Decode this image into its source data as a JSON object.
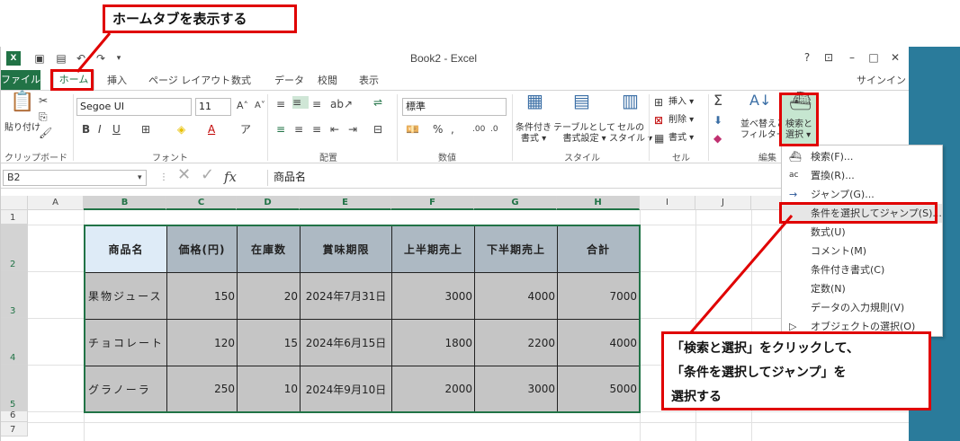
{
  "window": {
    "title": "Book2 - Excel",
    "help": "?",
    "signin": "サインイン"
  },
  "tabs": [
    "ファイル",
    "ホーム",
    "挿入",
    "ページ レイアウト",
    "数式",
    "データ",
    "校閲",
    "表示"
  ],
  "ribbon": {
    "paste": "貼り付け",
    "font_name": "Segoe UI",
    "font_size": "11",
    "number_format": "標準",
    "styles": {
      "conditional": "条件付き\n書式 ▾",
      "table": "テーブルとして\n書式設定 ▾",
      "cell": "セルの\nスタイル ▾"
    },
    "cells": {
      "insert": "挿入 ▾",
      "delete": "削除 ▾",
      "format": "書式 ▾"
    },
    "edit": {
      "sort": "並べ替えと\nフィルター ▾",
      "find": "検索と\n選択 ▾"
    },
    "groups": [
      "クリップボード",
      "フォント",
      "配置",
      "数値",
      "スタイル",
      "セル",
      "編集"
    ]
  },
  "formula_bar": {
    "name_box": "B2",
    "fx": "fx",
    "content": "商品名"
  },
  "columns": [
    "A",
    "B",
    "C",
    "D",
    "E",
    "F",
    "G",
    "H",
    "I",
    "J",
    "K"
  ],
  "rows": [
    "1",
    "2",
    "3",
    "4",
    "5",
    "6",
    "7"
  ],
  "table": {
    "headers": [
      "商品名",
      "価格(円)",
      "在庫数",
      "賞味期限",
      "上半期売上",
      "下半期売上",
      "合計"
    ],
    "rows": [
      [
        "果物ジュース",
        "150",
        "20",
        "2024年7月31日",
        "3000",
        "4000",
        "7000"
      ],
      [
        "チョコレート",
        "120",
        "15",
        "2024年6月15日",
        "1800",
        "2200",
        "4000"
      ],
      [
        "グラノーラ",
        "250",
        "10",
        "2024年9月10日",
        "2000",
        "3000",
        "5000"
      ]
    ]
  },
  "menu": [
    {
      "icon": "binoculars-icon",
      "label": "検索(F)..."
    },
    {
      "icon": "replace-icon",
      "label": "置換(R)..."
    },
    {
      "icon": "arrow-right-icon",
      "label": "ジャンプ(G)..."
    },
    {
      "icon": "",
      "label": "条件を選択してジャンプ(S)..."
    },
    {
      "icon": "",
      "label": "数式(U)"
    },
    {
      "icon": "",
      "label": "コメント(M)"
    },
    {
      "icon": "",
      "label": "条件付き書式(C)"
    },
    {
      "icon": "",
      "label": "定数(N)"
    },
    {
      "icon": "",
      "label": "データの入力規則(V)"
    },
    {
      "icon": "cursor-icon",
      "label": "オブジェクトの選択(O)"
    }
  ],
  "callouts": {
    "home_tab": "ホームタブを表示する",
    "find_select": "「検索と選択」をクリックして、\n「条件を選択してジャンプ」を\n選択する"
  },
  "colors": {
    "excel_green": "#217346",
    "annotation_red": "#e00000",
    "desktop": "#2a7b9b"
  }
}
